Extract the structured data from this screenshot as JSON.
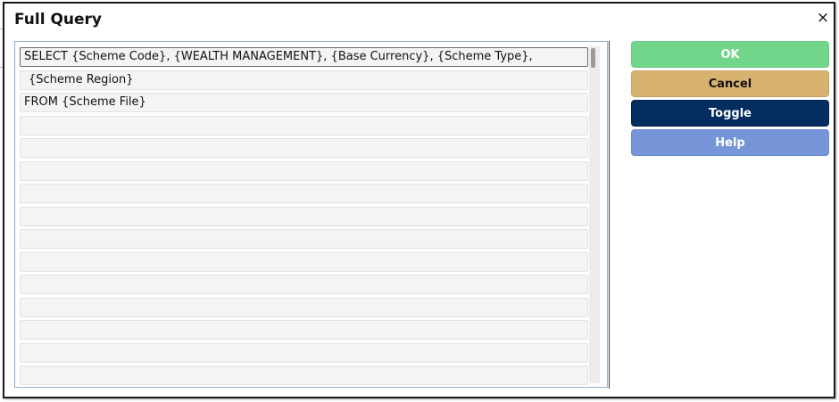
{
  "dialog": {
    "title": "Full Query",
    "close_glyph": "×"
  },
  "query": {
    "lines": [
      "SELECT {Scheme Code}, {WEALTH MANAGEMENT}, {Base Currency}, {Scheme Type},",
      "{Scheme Region}",
      "FROM {Scheme File}",
      "",
      "",
      "",
      "",
      "",
      "",
      "",
      "",
      "",
      "",
      "",
      ""
    ]
  },
  "buttons": {
    "ok": "OK",
    "cancel": "Cancel",
    "toggle": "Toggle",
    "help": "Help"
  },
  "colors": {
    "ok": "#72d68a",
    "cancel": "#d8b370",
    "toggle": "#032d5e",
    "help": "#7695d8",
    "row_background": "#f4f4f4",
    "query_border": "#8fb0cf"
  }
}
